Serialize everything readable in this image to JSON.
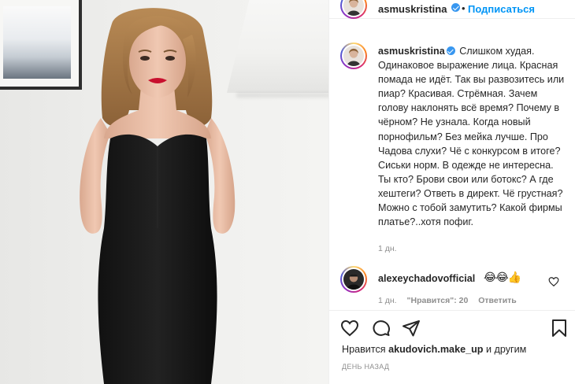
{
  "photo": {
    "alt_visual": "woman in black strapless dress"
  },
  "header": {
    "username": "asmuskristina",
    "dot": "•",
    "follow_label": "Подписаться"
  },
  "caption": {
    "username": "asmuskristina",
    "text": "Слишком худая. Одинаковое выражение лица. Красная помада не идёт. Так вы развозитесь или пиар? Красивая. Стрёмная. Зачем голову наклонять всё время? Почему в чёрном? Не узнала. Когда новый порнофильм? Без мейка лучше. Про Чадова слухи? Чё с конкурсом в итоге? Сиськи норм. В одежде не интересна. Ты кто? Брови свои или ботокс? А где хештеги? Ответь в директ. Чё грустная? Можно с тобой замутить? Какой фирмы платье?..хотя пофиг.",
    "time": "1 дн."
  },
  "comment": {
    "username": "alexeychadovofficial",
    "emoji": "😂😂👍",
    "time": "1 дн.",
    "likes": "\"Нравится\": 20",
    "reply": "Ответить"
  },
  "actions": {
    "like_icon": "heart-icon",
    "comment_icon": "comment-icon",
    "share_icon": "share-icon",
    "save_icon": "bookmark-icon"
  },
  "likes_line": {
    "prefix": "Нравится",
    "user": "akudovich.make_up",
    "suffix": "и другим"
  },
  "date": "День назад",
  "colors": {
    "link": "#0095f6",
    "verified": "#3897f0",
    "muted": "#8e8e8e",
    "text": "#262626"
  }
}
